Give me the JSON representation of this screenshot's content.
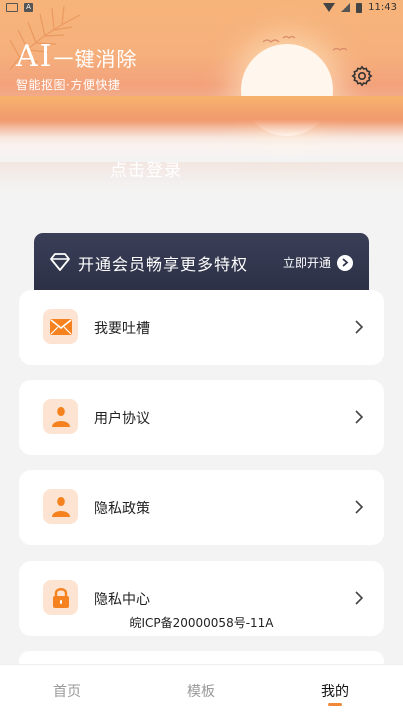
{
  "status_bar": {
    "time": "11:43"
  },
  "header": {
    "title_ai": "AI",
    "title_rest": "一键消除",
    "subtitle": "智能抠图·方便快捷",
    "login": "点击登录"
  },
  "vip": {
    "text": "开通会员畅享更多特权",
    "cta": "立即开通"
  },
  "menu": [
    {
      "label": "我要吐槽",
      "icon": "mail-icon"
    },
    {
      "label": "用户协议",
      "icon": "user-icon"
    },
    {
      "label": "隐私政策",
      "icon": "user-icon"
    },
    {
      "label": "隐私中心",
      "icon": "lock-icon"
    }
  ],
  "footer": {
    "icp": "皖ICP备20000058号-11A"
  },
  "nav": [
    {
      "label": "首页",
      "active": false
    },
    {
      "label": "模板",
      "active": false
    },
    {
      "label": "我的",
      "active": true
    }
  ],
  "colors": {
    "accent": "#f08a3a",
    "vip_bg": "#2f3349",
    "icon_bg": "#fde4d2"
  }
}
